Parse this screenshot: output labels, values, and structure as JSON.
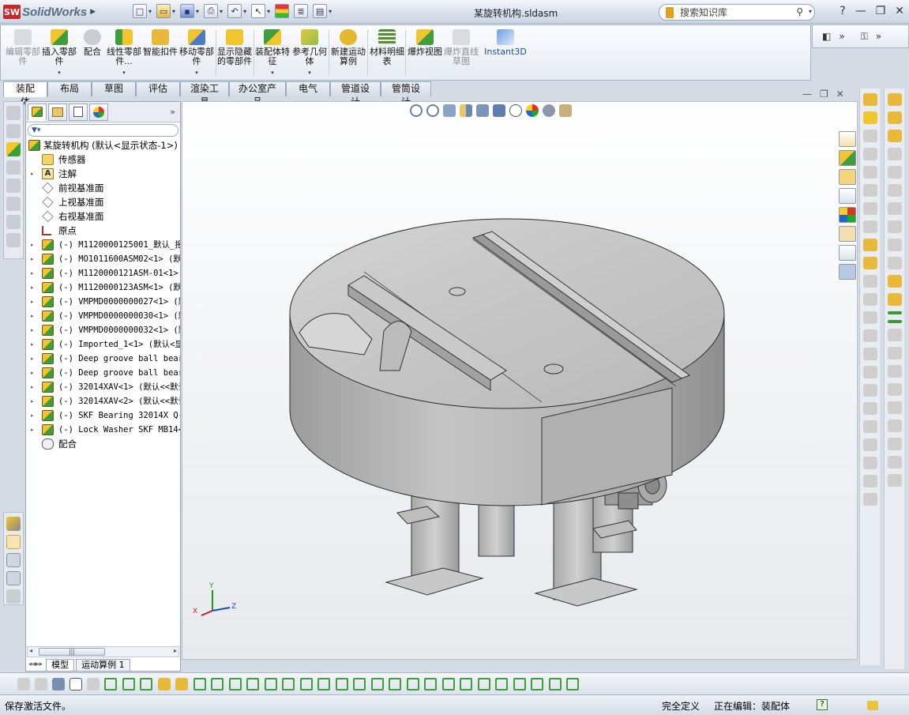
{
  "app": {
    "logo_abbr": "SW",
    "brand": "SolidWorks",
    "document_title": "某旋转机构.sldasm"
  },
  "search": {
    "placeholder": "搜索知识库"
  },
  "window_controls": {
    "help": "?",
    "minimize": "—",
    "restore": "❐",
    "close": "✕"
  },
  "ribbon": {
    "buttons": [
      {
        "label": "编辑零部件",
        "disabled": true
      },
      {
        "label": "插入零部件",
        "disabled": false
      },
      {
        "label": "配合",
        "disabled": false
      },
      {
        "label": "线性零部件...",
        "disabled": false
      },
      {
        "label": "智能扣件",
        "disabled": false
      },
      {
        "label": "移动零部件",
        "disabled": false
      },
      {
        "label": "显示隐藏的零部件",
        "disabled": false
      },
      {
        "label": "装配体特征",
        "disabled": false
      },
      {
        "label": "参考几何体",
        "disabled": false
      },
      {
        "label": "新建运动算例",
        "disabled": false
      },
      {
        "label": "材料明细表",
        "disabled": false
      },
      {
        "label": "爆炸视图",
        "disabled": false
      },
      {
        "label": "爆炸直线草图",
        "disabled": true
      },
      {
        "label": "Instant3D",
        "disabled": false
      }
    ],
    "more": "»"
  },
  "command_tabs": [
    "装配体",
    "布局",
    "草图",
    "评估",
    "渲染工具",
    "办公室产品",
    "电气",
    "管道设计",
    "管筒设计"
  ],
  "feature_manager": {
    "more": "»",
    "root": "某旋转机构  (默认<显示状态-1>)",
    "items": [
      {
        "label": "传感器",
        "icon": "sensor-icon",
        "mono": false
      },
      {
        "label": "注解",
        "icon": "annotation-icon",
        "mono": false,
        "expand": true
      },
      {
        "label": "前视基准面",
        "icon": "plane-icon",
        "mono": false
      },
      {
        "label": "上视基准面",
        "icon": "plane-icon",
        "mono": false
      },
      {
        "label": "右视基准面",
        "icon": "plane-icon",
        "mono": false
      },
      {
        "label": "原点",
        "icon": "origin-icon",
        "mono": false
      },
      {
        "label": "(-) M1120000125001_默认_报",
        "icon": "assembly-icon",
        "mono": true,
        "expand": true
      },
      {
        "label": "(-) MO1011600ASM02<1> (默认",
        "icon": "assembly-icon",
        "mono": true,
        "expand": true
      },
      {
        "label": "(-) M1120000121ASM-01<1>",
        "icon": "assembly-icon",
        "mono": true,
        "expand": true
      },
      {
        "label": "(-) M1120000123ASM<1> (默认",
        "icon": "assembly-icon",
        "mono": true,
        "expand": true
      },
      {
        "label": "(-) VMPMD0000000027<1> (默",
        "icon": "assembly-icon",
        "mono": true,
        "expand": true
      },
      {
        "label": "(-) VMPMD0000000030<1> (默",
        "icon": "assembly-icon",
        "mono": true,
        "expand": true
      },
      {
        "label": "(-) VMPMD0000000032<1> (默",
        "icon": "assembly-icon",
        "mono": true,
        "expand": true
      },
      {
        "label": "(-) Imported_1<1> (默认<显",
        "icon": "assembly-icon",
        "mono": true,
        "expand": true
      },
      {
        "label": "(-) Deep groove ball bear:",
        "icon": "assembly-icon",
        "mono": true,
        "expand": true
      },
      {
        "label": "(-) Deep groove ball bear:",
        "icon": "assembly-icon",
        "mono": true,
        "expand": true
      },
      {
        "label": "(-) 32014XAV<1> (默认<<默认",
        "icon": "assembly-icon",
        "mono": true,
        "expand": true
      },
      {
        "label": "(-) 32014XAV<2> (默认<<默认",
        "icon": "assembly-icon",
        "mono": true,
        "expand": true
      },
      {
        "label": "(-) SKF Bearing  32014X Q-",
        "icon": "assembly-icon",
        "mono": true,
        "expand": true
      },
      {
        "label": "(-) Lock Washer SKF MB14<1",
        "icon": "assembly-icon",
        "mono": true,
        "expand": true
      },
      {
        "label": "配合",
        "icon": "mates-icon",
        "mono": false
      }
    ],
    "bottom_tabs": [
      "模型",
      "运动算例 1"
    ]
  },
  "triad": {
    "x": "X",
    "y": "Y",
    "z": "Z"
  },
  "status": {
    "left": "保存激活文件。",
    "definition": "完全定义",
    "editing": "正在编辑：装配体",
    "help": "?"
  },
  "colors": {
    "accent": "#2a5aa8",
    "viewport_top": "#ffffff",
    "viewport_bottom": "#e7e9ed",
    "model_gray": "#b9b9b9"
  }
}
